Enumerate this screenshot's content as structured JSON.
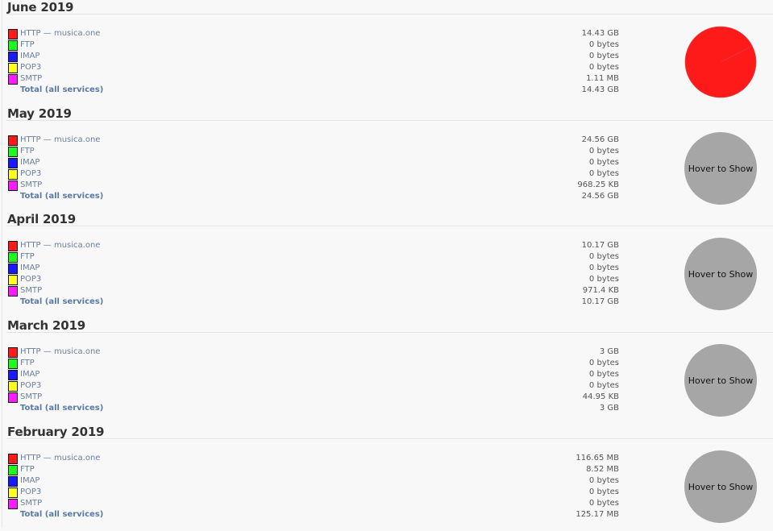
{
  "legend_colors": {
    "HTTP": "#ff1a1a",
    "FTP": "#1aff1a",
    "IMAP": "#1a1aff",
    "POP3": "#ffff1a",
    "SMTP": "#ff1aff"
  },
  "hover_label": "Hover to Show",
  "total_label": "Total (all services)",
  "months": [
    {
      "title": "June 2019",
      "chart_shown": true,
      "rows": [
        {
          "service": "HTTP",
          "label": "HTTP — musica.one",
          "value": "14.43 GB"
        },
        {
          "service": "FTP",
          "label": "FTP",
          "value": "0 bytes"
        },
        {
          "service": "IMAP",
          "label": "IMAP",
          "value": "0 bytes"
        },
        {
          "service": "POP3",
          "label": "POP3",
          "value": "0 bytes"
        },
        {
          "service": "SMTP",
          "label": "SMTP",
          "value": "1.11 MB"
        }
      ],
      "total": "14.43 GB"
    },
    {
      "title": "May 2019",
      "chart_shown": false,
      "rows": [
        {
          "service": "HTTP",
          "label": "HTTP — musica.one",
          "value": "24.56 GB"
        },
        {
          "service": "FTP",
          "label": "FTP",
          "value": "0 bytes"
        },
        {
          "service": "IMAP",
          "label": "IMAP",
          "value": "0 bytes"
        },
        {
          "service": "POP3",
          "label": "POP3",
          "value": "0 bytes"
        },
        {
          "service": "SMTP",
          "label": "SMTP",
          "value": "968.25 KB"
        }
      ],
      "total": "24.56 GB"
    },
    {
      "title": "April 2019",
      "chart_shown": false,
      "rows": [
        {
          "service": "HTTP",
          "label": "HTTP — musica.one",
          "value": "10.17 GB"
        },
        {
          "service": "FTP",
          "label": "FTP",
          "value": "0 bytes"
        },
        {
          "service": "IMAP",
          "label": "IMAP",
          "value": "0 bytes"
        },
        {
          "service": "POP3",
          "label": "POP3",
          "value": "0 bytes"
        },
        {
          "service": "SMTP",
          "label": "SMTP",
          "value": "971.4 KB"
        }
      ],
      "total": "10.17 GB"
    },
    {
      "title": "March 2019",
      "chart_shown": false,
      "rows": [
        {
          "service": "HTTP",
          "label": "HTTP — musica.one",
          "value": "3 GB"
        },
        {
          "service": "FTP",
          "label": "FTP",
          "value": "0 bytes"
        },
        {
          "service": "IMAP",
          "label": "IMAP",
          "value": "0 bytes"
        },
        {
          "service": "POP3",
          "label": "POP3",
          "value": "0 bytes"
        },
        {
          "service": "SMTP",
          "label": "SMTP",
          "value": "44.95 KB"
        }
      ],
      "total": "3 GB"
    },
    {
      "title": "February 2019",
      "chart_shown": false,
      "rows": [
        {
          "service": "HTTP",
          "label": "HTTP — musica.one",
          "value": "116.65 MB"
        },
        {
          "service": "FTP",
          "label": "FTP",
          "value": "8.52 MB"
        },
        {
          "service": "IMAP",
          "label": "IMAP",
          "value": "0 bytes"
        },
        {
          "service": "POP3",
          "label": "POP3",
          "value": "0 bytes"
        },
        {
          "service": "SMTP",
          "label": "SMTP",
          "value": "0 bytes"
        }
      ],
      "total": "125.17 MB"
    }
  ],
  "chart_data": {
    "type": "pie",
    "title": "June 2019",
    "categories": [
      "HTTP",
      "FTP",
      "IMAP",
      "POP3",
      "SMTP"
    ],
    "values": [
      14776.32,
      0,
      0,
      0,
      1.11
    ],
    "unit": "MB"
  }
}
